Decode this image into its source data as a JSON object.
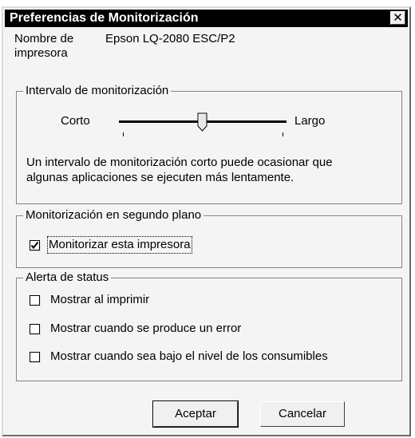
{
  "window": {
    "title": "Preferencias de Monitorización",
    "close_symbol": "✕"
  },
  "printer": {
    "name_label_line1": "Nombre de",
    "name_label_line2": "impresora",
    "name_value": "Epson LQ-2080 ESC/P2"
  },
  "interval_group": {
    "legend": "Intervalo de monitorización",
    "min_label": "Corto",
    "max_label": "Largo",
    "slider_value_fraction": 0.5,
    "description_line1": "Un intervalo de monitorización corto puede ocasionar que",
    "description_line2": "algunas aplicaciones se ejecuten más lentamente."
  },
  "background_group": {
    "legend": "Monitorización en segundo plano",
    "monitor_checkbox": {
      "label": "Monitorizar esta impresora",
      "checked": true
    }
  },
  "status_group": {
    "legend": "Alerta de status",
    "options": [
      {
        "label": "Mostrar al imprimir",
        "checked": false
      },
      {
        "label": "Mostrar cuando se produce un error",
        "checked": false
      },
      {
        "label": "Mostrar cuando sea bajo el nivel de los consumibles",
        "checked": false
      }
    ]
  },
  "buttons": {
    "ok": "Aceptar",
    "cancel": "Cancelar"
  }
}
